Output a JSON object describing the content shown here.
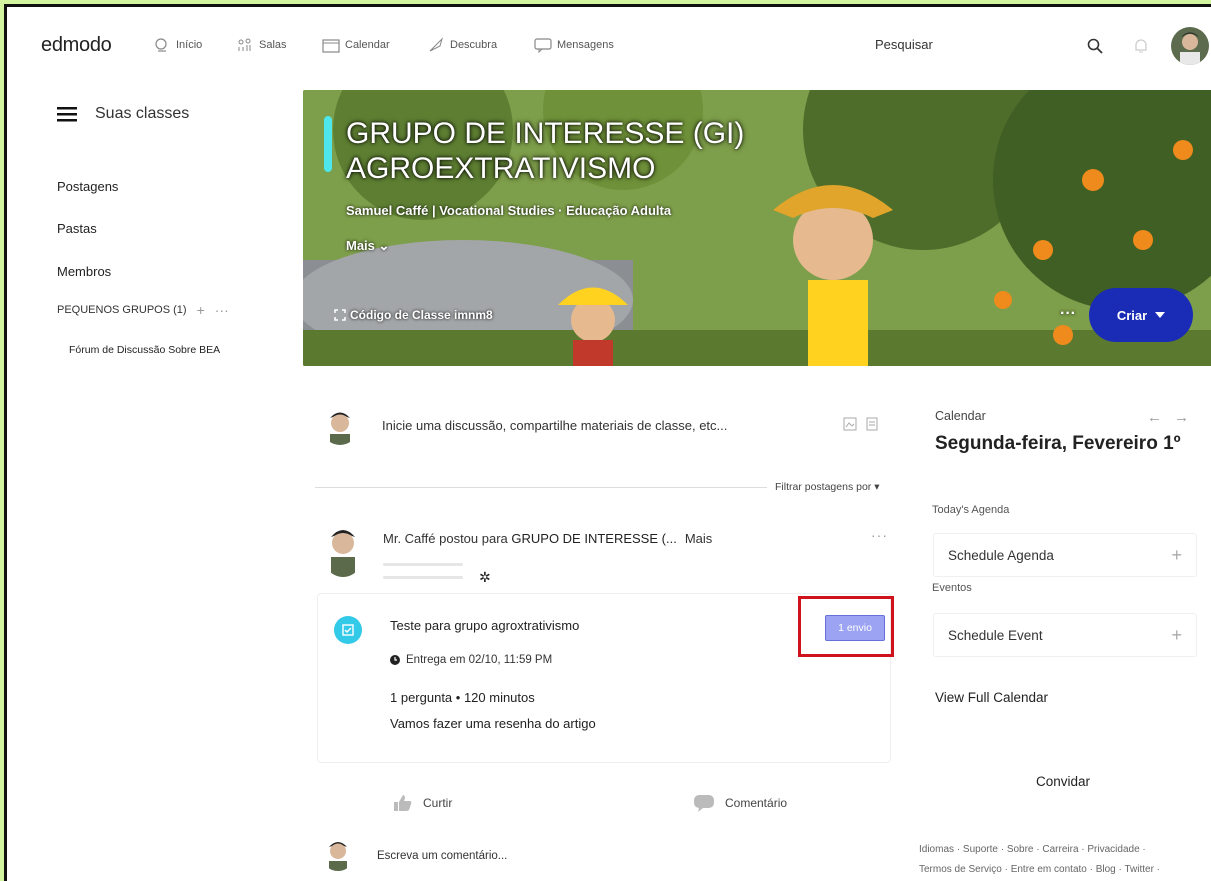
{
  "nav": {
    "logo": "edmodo",
    "items": [
      {
        "label": "Início",
        "icon": "home-icon"
      },
      {
        "label": "Salas",
        "icon": "classes-icon"
      },
      {
        "label": "Calendar",
        "icon": "calendar-icon"
      },
      {
        "label": "Descubra",
        "icon": "rocket-icon"
      },
      {
        "label": "Mensagens",
        "icon": "message-icon"
      }
    ],
    "search_label": "Pesquisar"
  },
  "sidebar": {
    "title": "Suas classes",
    "links": [
      "Postagens",
      "Pastas",
      "Membros"
    ],
    "small_groups_label": "PEQUENOS GRUPOS (1)",
    "small_groups_add": "+",
    "small_groups_more": "···",
    "forum": "Fórum de Discussão Sobre BEA"
  },
  "banner": {
    "title_line1": "GRUPO DE INTERESSE (GI)",
    "title_line2": "AGROEXTRATIVISMO",
    "subtitle": "Samuel Caffé | Vocational Studies · Educação Adulta",
    "more": "Mais ⌄",
    "class_code": "Código de Classe imnm8",
    "dots": "···",
    "create_button": "Criar"
  },
  "composer": {
    "placeholder": "Inicie uma discussão, compartilhe materiais de classe, etc...",
    "filter": "Filtrar postagens por ▾"
  },
  "post": {
    "author_prefix": "Mr. Caffé postou para ",
    "group": "GRUPO DE INTERESSE (...",
    "more": "Mais",
    "menu": "···",
    "assignment": {
      "title": "Teste para grupo agroxtrativismo",
      "due": "Entrega em 02/10, 11:59 PM",
      "info": "1 pergunta • 120 minutos",
      "description": "Vamos fazer uma resenha do artigo",
      "submissions_badge": "1 envio"
    },
    "like": "Curtir",
    "comment": "Comentário",
    "write_comment": "Escreva um comentário..."
  },
  "calendar": {
    "label": "Calendar",
    "date": "Segunda-feira, Fevereiro 1º",
    "agenda_label": "Today's Agenda",
    "schedule_agenda": "Schedule Agenda",
    "events_label": "Eventos",
    "schedule_event": "Schedule Event",
    "view_full": "View Full Calendar"
  },
  "invite": "Convidar",
  "footer": {
    "line1": "Idiomas · Suporte · Sobre · Carreira · Privacidade ·",
    "line2": "Termos de Serviço · Entre em contato · Blog · Twitter ·"
  },
  "colors": {
    "page_bg": "#d3f5a0",
    "accent_blue": "#1a2bb5",
    "badge": "#9ba3f2",
    "highlight": "#d0121c",
    "assignment_icon": "#33c9e8"
  }
}
